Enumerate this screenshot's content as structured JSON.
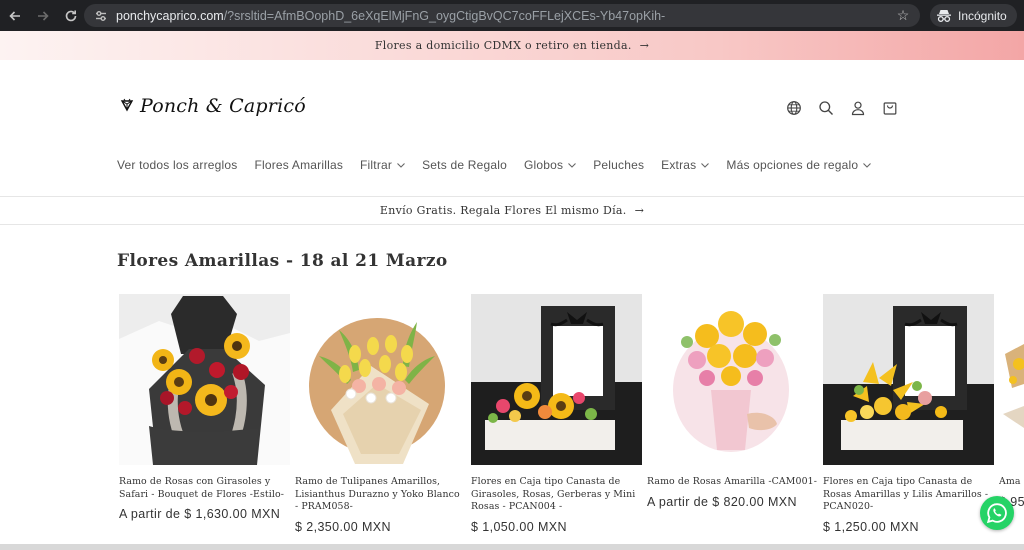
{
  "browser": {
    "url_host": "ponchycaprico.com",
    "url_path": "/?srsltid=AfmBOophD_6eXqElMjFnG_oygCtigBvQC7coFFLejXCEs-Yb47opKih-",
    "incognito_label": "Incógnito"
  },
  "announcement": {
    "text": "Flores a domicilio CDMX o retiro en tienda.",
    "arrow": "→"
  },
  "header": {
    "logo_text": "Ponch & Capricó"
  },
  "menu": {
    "items": [
      {
        "label": "Ver todos los arreglos",
        "dropdown": false
      },
      {
        "label": "Flores Amarillas",
        "dropdown": false
      },
      {
        "label": "Filtrar",
        "dropdown": true
      },
      {
        "label": "Sets de Regalo",
        "dropdown": false
      },
      {
        "label": "Globos",
        "dropdown": true
      },
      {
        "label": "Peluches",
        "dropdown": false
      },
      {
        "label": "Extras",
        "dropdown": true
      },
      {
        "label": "Más opciones de regalo",
        "dropdown": true
      }
    ],
    "chevron": "⌄"
  },
  "promo": {
    "text": "Envío Gratis. Regala Flores El mismo Día.",
    "arrow": "→"
  },
  "collection": {
    "title": "Flores Amarillas - 18 al 21 Marzo",
    "products": [
      {
        "name": "Ramo de Rosas con Girasoles y Safari - Bouquet de Flores -Estilo-",
        "price": "A partir de $ 1,630.00 MXN"
      },
      {
        "name": "Ramo de Tulipanes Amarillos, Lisianthus Durazno y Yoko Blanco - PRAM058-",
        "price": "$ 2,350.00 MXN"
      },
      {
        "name": "Flores en Caja tipo Canasta de Girasoles, Rosas, Gerberas y Mini Rosas - PCAN004 -",
        "price": "$ 1,050.00 MXN"
      },
      {
        "name": "Ramo de Rosas Amarilla -CAM001-",
        "price": "A partir de $ 820.00 MXN"
      },
      {
        "name": "Flores en Caja tipo Canasta de Rosas Amarillas y Lilis Amarillos - PCAN020-",
        "price": "$ 1,250.00 MXN"
      },
      {
        "name": "Ama",
        "price": "$ 95"
      }
    ]
  },
  "colors": {
    "chrome_bg": "#202124",
    "announce_pink": "#f3a6a6",
    "whatsapp_green": "#25d366"
  }
}
